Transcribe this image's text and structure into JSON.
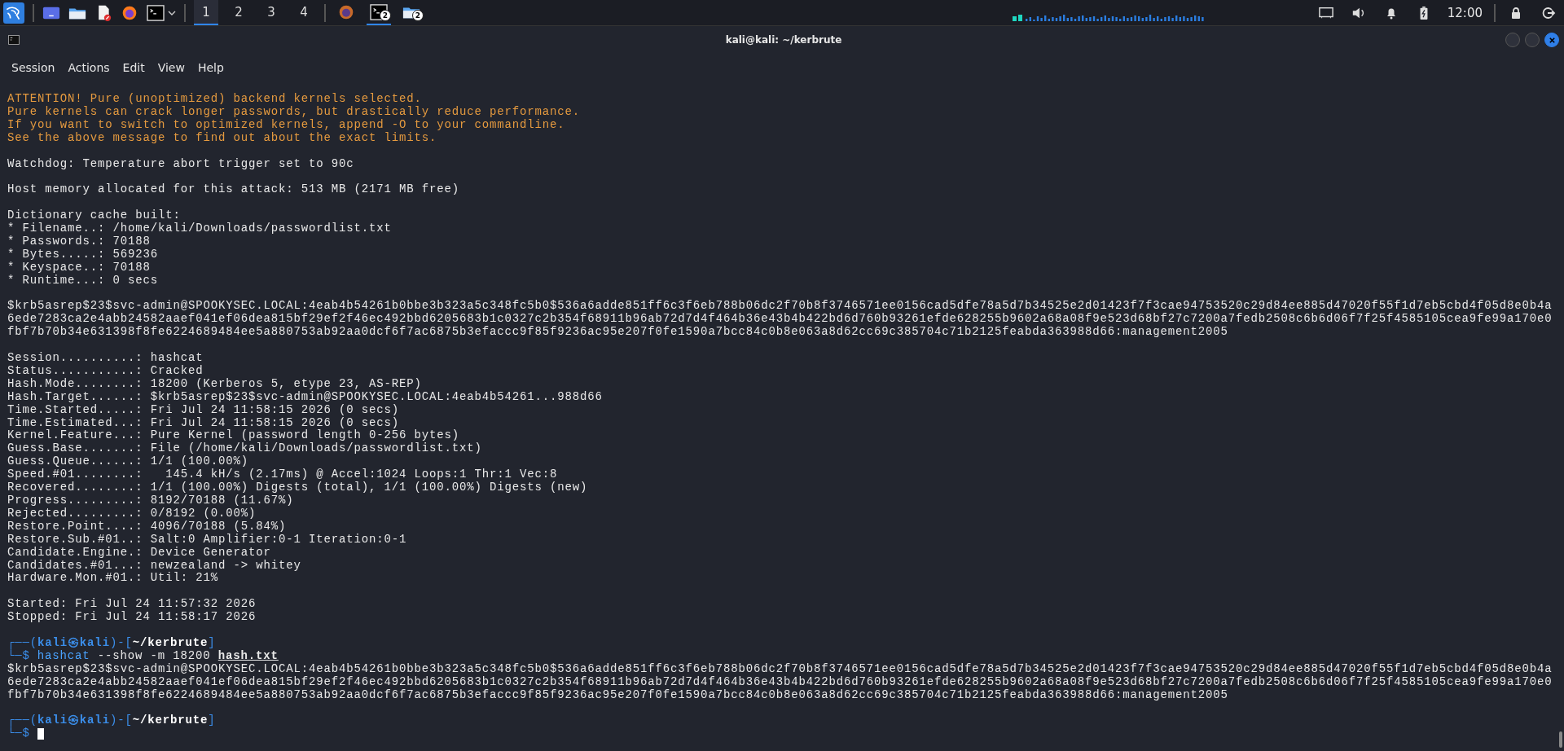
{
  "taskbar": {
    "workspaces": [
      {
        "label": "1",
        "selected": true
      },
      {
        "label": "2",
        "selected": false
      },
      {
        "label": "3",
        "selected": false
      },
      {
        "label": "4",
        "selected": false
      }
    ],
    "tasks": [
      {
        "kind": "browser",
        "selected": false
      },
      {
        "kind": "terminal",
        "badge": "2",
        "selected": true
      },
      {
        "kind": "folder",
        "badge": "2",
        "selected": false
      }
    ],
    "clock": "12:00"
  },
  "window": {
    "title": "kali@kali: ~/kerbrute",
    "menu": [
      "Session",
      "Actions",
      "Edit",
      "View",
      "Help"
    ]
  },
  "terminal": {
    "lines": [
      {
        "kind": "warning",
        "text": "ATTENTION! Pure (unoptimized) backend kernels selected."
      },
      {
        "kind": "warning",
        "text": "Pure kernels can crack longer passwords, but drastically reduce performance."
      },
      {
        "kind": "warning",
        "text": "If you want to switch to optimized kernels, append -O to your commandline."
      },
      {
        "kind": "warning",
        "text": "See the above message to find out about the exact limits."
      },
      {
        "kind": "blank"
      },
      {
        "kind": "output",
        "text": "Watchdog: Temperature abort trigger set to 90c"
      },
      {
        "kind": "blank"
      },
      {
        "kind": "output",
        "text": "Host memory allocated for this attack: 513 MB (2171 MB free)"
      },
      {
        "kind": "blank"
      },
      {
        "kind": "output",
        "text": "Dictionary cache built:"
      },
      {
        "kind": "output",
        "text": "* Filename..: /home/kali/Downloads/passwordlist.txt"
      },
      {
        "kind": "output",
        "text": "* Passwords.: 70188"
      },
      {
        "kind": "output",
        "text": "* Bytes.....: 569236"
      },
      {
        "kind": "output",
        "text": "* Keyspace..: 70188"
      },
      {
        "kind": "output",
        "text": "* Runtime...: 0 secs"
      },
      {
        "kind": "blank"
      },
      {
        "kind": "hash",
        "text": "$krb5asrep$23$svc-admin@SPOOKYSEC.LOCAL:4eab4b54261b0bbe3b323a5c348fc5b0$536a6adde851ff6c3f6eb788b06dc2f70b8f3746571ee0156cad5dfe78a5d7b34525e2d01423f7f3cae94753520c29d84ee885d47020f55f1d7eb5cbd4f05d8e0b4a6ede7283ca2e4abb24582aaef041ef06dea815bf29ef2f46ec492bbd6205683b1c0327c2b354f68911b96ab72d7d4f464b36e43b4b422bd6d760b93261efde628255b9602a68a08f9e523d68bf27c7200a7fedb2508c6b6d06f7f25f4585105cea9fe99a170e0fbf7b70b34e631398f8fe6224689484ee5a880753ab92aa0dcf6f7ac6875b3efaccc9f85f9236ac95e207f0fe1590a7bcc84c0b8e063a8d62cc69c385704c71b2125feabda363988d66:management2005"
      },
      {
        "kind": "blank"
      },
      {
        "kind": "output",
        "text": "Session..........: hashcat"
      },
      {
        "kind": "output",
        "text": "Status...........: Cracked"
      },
      {
        "kind": "output",
        "text": "Hash.Mode........: 18200 (Kerberos 5, etype 23, AS-REP)"
      },
      {
        "kind": "output",
        "text": "Hash.Target......: $krb5asrep$23$svc-admin@SPOOKYSEC.LOCAL:4eab4b54261...988d66"
      },
      {
        "kind": "output",
        "text": "Time.Started.....: Fri Jul 24 11:58:15 2026 (0 secs)"
      },
      {
        "kind": "output",
        "text": "Time.Estimated...: Fri Jul 24 11:58:15 2026 (0 secs)"
      },
      {
        "kind": "output",
        "text": "Kernel.Feature...: Pure Kernel (password length 0-256 bytes)"
      },
      {
        "kind": "output",
        "text": "Guess.Base.......: File (/home/kali/Downloads/passwordlist.txt)"
      },
      {
        "kind": "output",
        "text": "Guess.Queue......: 1/1 (100.00%)"
      },
      {
        "kind": "output",
        "text": "Speed.#01........:   145.4 kH/s (2.17ms) @ Accel:1024 Loops:1 Thr:1 Vec:8"
      },
      {
        "kind": "output",
        "text": "Recovered........: 1/1 (100.00%) Digests (total), 1/1 (100.00%) Digests (new)"
      },
      {
        "kind": "output",
        "text": "Progress.........: 8192/70188 (11.67%)"
      },
      {
        "kind": "output",
        "text": "Rejected.........: 0/8192 (0.00%)"
      },
      {
        "kind": "output",
        "text": "Restore.Point....: 4096/70188 (5.84%)"
      },
      {
        "kind": "output",
        "text": "Restore.Sub.#01..: Salt:0 Amplifier:0-1 Iteration:0-1"
      },
      {
        "kind": "output",
        "text": "Candidate.Engine.: Device Generator"
      },
      {
        "kind": "output",
        "text": "Candidates.#01...: newzealand -> whitey"
      },
      {
        "kind": "output",
        "text": "Hardware.Mon.#01.: Util: 21%"
      },
      {
        "kind": "blank"
      },
      {
        "kind": "output",
        "text": "Started: Fri Jul 24 11:57:32 2026"
      },
      {
        "kind": "output",
        "text": "Stopped: Fri Jul 24 11:58:17 2026"
      },
      {
        "kind": "blank"
      },
      {
        "kind": "prompt",
        "open": "┌──(",
        "user": "kali㉿kali",
        "mid": ")-[",
        "cwd": "~/kerbrute",
        "close": "]"
      },
      {
        "kind": "input",
        "prompt": "└─$",
        "command": "hashcat",
        "args": "--show -m 18200",
        "file": "hash.txt"
      },
      {
        "kind": "hash",
        "text": "$krb5asrep$23$svc-admin@SPOOKYSEC.LOCAL:4eab4b54261b0bbe3b323a5c348fc5b0$536a6adde851ff6c3f6eb788b06dc2f70b8f3746571ee0156cad5dfe78a5d7b34525e2d01423f7f3cae94753520c29d84ee885d47020f55f1d7eb5cbd4f05d8e0b4a6ede7283ca2e4abb24582aaef041ef06dea815bf29ef2f46ec492bbd6205683b1c0327c2b354f68911b96ab72d7d4f464b36e43b4b422bd6d760b93261efde628255b9602a68a08f9e523d68bf27c7200a7fedb2508c6b6d06f7f25f4585105cea9fe99a170e0fbf7b70b34e631398f8fe6224689484ee5a880753ab92aa0dcf6f7ac6875b3efaccc9f85f9236ac95e207f0fe1590a7bcc84c0b8e063a8d62cc69c385704c71b2125feabda363988d66:management2005"
      },
      {
        "kind": "blank"
      },
      {
        "kind": "prompt",
        "open": "┌──(",
        "user": "kali㉿kali",
        "mid": ")-[",
        "cwd": "~/kerbrute",
        "close": "]"
      },
      {
        "kind": "input",
        "prompt": "└─$",
        "cursor": true
      }
    ]
  }
}
